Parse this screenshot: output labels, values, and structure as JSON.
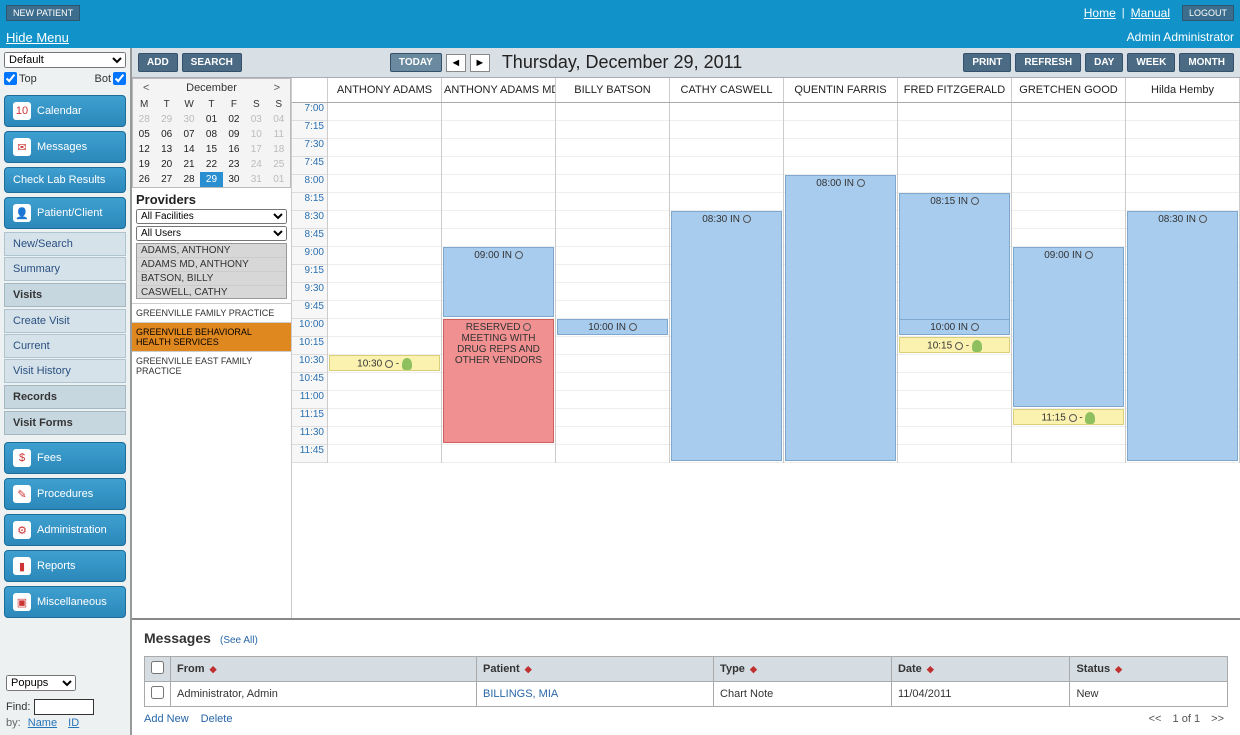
{
  "header": {
    "new_patient": "NEW PATIENT",
    "home": "Home",
    "manual": "Manual",
    "logout": "LOGOUT",
    "hide_menu": "Hide Menu",
    "user": "Admin Administrator"
  },
  "sidebar": {
    "group_select": "Default",
    "top_label": "Top",
    "bot_label": "Bot",
    "nav": [
      {
        "icon": "10",
        "label": "Calendar"
      },
      {
        "icon": "✉",
        "label": "Messages"
      }
    ],
    "check_lab": "Check Lab Results",
    "patient_client": "Patient/Client",
    "subs1": [
      "New/Search",
      "Summary"
    ],
    "visits_heading": "Visits",
    "subs2": [
      "Create Visit",
      "Current",
      "Visit History"
    ],
    "records_heading": "Records",
    "visitforms_heading": "Visit Forms",
    "nav2": [
      {
        "icon": "$",
        "label": "Fees"
      },
      {
        "icon": "✎",
        "label": "Procedures"
      },
      {
        "icon": "⚙",
        "label": "Administration"
      },
      {
        "icon": "▮",
        "label": "Reports"
      },
      {
        "icon": "▣",
        "label": "Miscellaneous"
      }
    ],
    "popups": "Popups",
    "find_label": "Find:",
    "by_label": "by:",
    "by_name": "Name",
    "by_id": "ID"
  },
  "toolbar": {
    "add": "ADD",
    "search": "SEARCH",
    "today": "TODAY",
    "date_title": "Thursday, December 29, 2011",
    "print": "PRINT",
    "refresh": "REFRESH",
    "day": "DAY",
    "week": "WEEK",
    "month": "MONTH"
  },
  "minical": {
    "month": "December",
    "dow": [
      "M",
      "T",
      "W",
      "T",
      "F",
      "S",
      "S"
    ],
    "weeks": [
      [
        {
          "d": "28",
          "o": true
        },
        {
          "d": "29",
          "o": true
        },
        {
          "d": "30",
          "o": true
        },
        {
          "d": "01"
        },
        {
          "d": "02"
        },
        {
          "d": "03",
          "o": true
        },
        {
          "d": "04",
          "o": true
        }
      ],
      [
        {
          "d": "05"
        },
        {
          "d": "06"
        },
        {
          "d": "07"
        },
        {
          "d": "08"
        },
        {
          "d": "09"
        },
        {
          "d": "10",
          "o": true
        },
        {
          "d": "11",
          "o": true
        }
      ],
      [
        {
          "d": "12"
        },
        {
          "d": "13"
        },
        {
          "d": "14"
        },
        {
          "d": "15"
        },
        {
          "d": "16"
        },
        {
          "d": "17",
          "o": true
        },
        {
          "d": "18",
          "o": true
        }
      ],
      [
        {
          "d": "19"
        },
        {
          "d": "20"
        },
        {
          "d": "21"
        },
        {
          "d": "22"
        },
        {
          "d": "23"
        },
        {
          "d": "24",
          "o": true
        },
        {
          "d": "25",
          "o": true
        }
      ],
      [
        {
          "d": "26"
        },
        {
          "d": "27"
        },
        {
          "d": "28"
        },
        {
          "d": "29",
          "t": true
        },
        {
          "d": "30"
        },
        {
          "d": "31",
          "o": true
        },
        {
          "d": "01",
          "o": true
        }
      ]
    ]
  },
  "providers": {
    "heading": "Providers",
    "facility_select": "All Facilities",
    "user_select": "All Users",
    "list": [
      "ADAMS, ANTHONY",
      "ADAMS MD, ANTHONY",
      "BATSON, BILLY",
      "CASWELL, CATHY"
    ],
    "facilities": [
      {
        "label": "GREENVILLE FAMILY PRACTICE"
      },
      {
        "label": "GREENVILLE BEHAVIORAL HEALTH SERVICES",
        "sel": true
      },
      {
        "label": "GREENVILLE EAST FAMILY PRACTICE"
      }
    ]
  },
  "schedule": {
    "columns": [
      "ANTHONY ADAMS",
      "ANTHONY ADAMS MD",
      "BILLY BATSON",
      "CATHY CASWELL",
      "QUENTIN FARRIS",
      "FRED FITZGERALD",
      "GRETCHEN GOOD",
      "Hilda Hemby"
    ],
    "times": [
      "7:00",
      "7:15",
      "7:30",
      "7:45",
      "8:00",
      "8:15",
      "8:30",
      "8:45",
      "9:00",
      "9:15",
      "9:30",
      "9:45",
      "10:00",
      "10:15",
      "10:30",
      "10:45",
      "11:00",
      "11:15",
      "11:30",
      "11:45"
    ],
    "appts": [
      {
        "col": 0,
        "start": 14,
        "span": 1,
        "text": "10:30 ⚙ -",
        "yellow": true,
        "person": true
      },
      {
        "col": 1,
        "start": 8,
        "span": 4,
        "text": "09:00 IN ⚙"
      },
      {
        "col": 1,
        "start": 12,
        "span": 7,
        "text": "RESERVED ⚙ MEETING WITH DRUG REPS AND OTHER VENDORS",
        "reserved": true
      },
      {
        "col": 2,
        "start": 12,
        "span": 1,
        "text": "10:00 IN ⚙"
      },
      {
        "col": 3,
        "start": 6,
        "span": 14,
        "text": "08:30 IN ⚙"
      },
      {
        "col": 4,
        "start": 4,
        "span": 16,
        "text": "08:00 IN ⚙"
      },
      {
        "col": 5,
        "start": 5,
        "span": 8,
        "text": "08:15 IN ⚙"
      },
      {
        "col": 5,
        "start": 12,
        "span": 1,
        "text": "10:00 IN ⚙"
      },
      {
        "col": 5,
        "start": 13,
        "span": 1,
        "text": "10:15 ⚙ -",
        "yellow": true,
        "person": true
      },
      {
        "col": 6,
        "start": 8,
        "span": 9,
        "text": "09:00 IN ⚙"
      },
      {
        "col": 6,
        "start": 17,
        "span": 1,
        "text": "11:15 ⚙ -",
        "yellow": true,
        "person": true
      },
      {
        "col": 7,
        "start": 6,
        "span": 14,
        "text": "08:30 IN ⚙"
      }
    ]
  },
  "messages": {
    "heading": "Messages",
    "see_all": "(See All)",
    "cols": [
      "From",
      "Patient",
      "Type",
      "Date",
      "Status"
    ],
    "rows": [
      {
        "from": "Administrator, Admin",
        "patient": "BILLINGS, MIA",
        "type": "Chart Note",
        "date": "11/04/2011",
        "status": "New"
      }
    ],
    "add_new": "Add New",
    "delete": "Delete",
    "pager": "1 of 1"
  }
}
